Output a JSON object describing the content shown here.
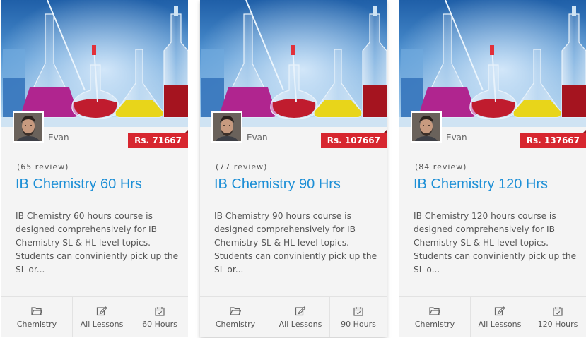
{
  "colors": {
    "accent": "#1d8fd6",
    "price_badge": "#d7262f",
    "card_background": "#f4f4f4"
  },
  "courses": [
    {
      "instructor": "Evan",
      "price": "Rs. 71667",
      "reviews": "(65 review)",
      "title": "IB Chemistry 60 Hrs",
      "description": "IB Chemistry 60 hours course is designed comprehensively for IB Chemistry SL & HL level topics. Students can conviniently pick up the SL or...",
      "category": "Chemistry",
      "lessons": "All Lessons",
      "hours": "60 Hours",
      "icons": [
        "folder-icon",
        "edit-icon",
        "calendar-icon"
      ]
    },
    {
      "instructor": "Evan",
      "price": "Rs. 107667",
      "reviews": "(77 review)",
      "title": "IB Chemistry 90 Hrs",
      "description": "IB Chemistry 90 hours course is designed comprehensively for IB Chemistry SL & HL level topics. Students can conviniently pick up the SL or...",
      "category": "Chemistry",
      "lessons": "All Lessons",
      "hours": "90 Hours",
      "icons": [
        "folder-icon",
        "edit-icon",
        "calendar-icon"
      ]
    },
    {
      "instructor": "Evan",
      "price": "Rs. 137667",
      "reviews": "(84 review)",
      "title": "IB Chemistry 120 Hrs",
      "description": "IB Chemistry 120 hours course is designed comprehensively for IB Chemistry SL & HL level topics. Students can conviniently pick up the SL o...",
      "category": "Chemistry",
      "lessons": "All Lessons",
      "hours": "120 Hours",
      "icons": [
        "folder-icon",
        "edit-icon",
        "calendar-icon"
      ]
    }
  ]
}
